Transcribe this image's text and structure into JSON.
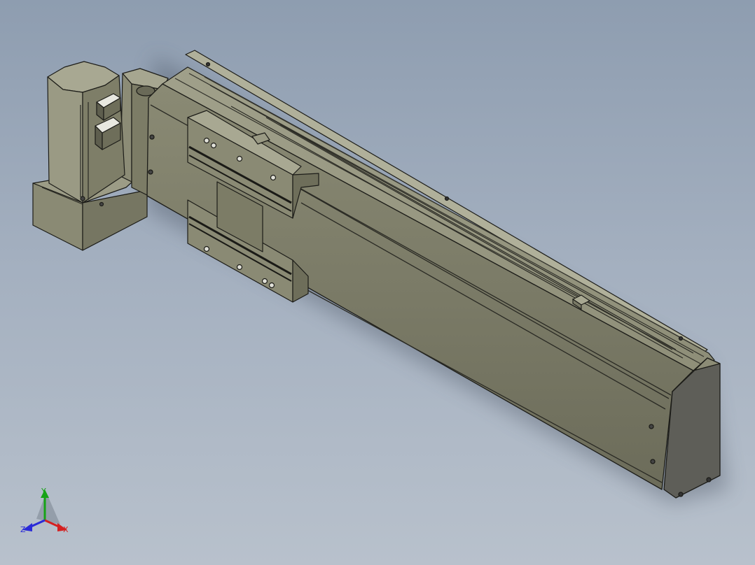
{
  "viewport": {
    "background_top": "#8e9db0",
    "background_bottom": "#b8c1cc",
    "model_color": "#7a7a66",
    "model_edge_color": "#1c1c18"
  },
  "triad": {
    "x_label": "X",
    "y_label": "Y",
    "z_label": "Z",
    "x_color": "#d42020",
    "y_color": "#16a316",
    "z_color": "#2a2ad8"
  }
}
